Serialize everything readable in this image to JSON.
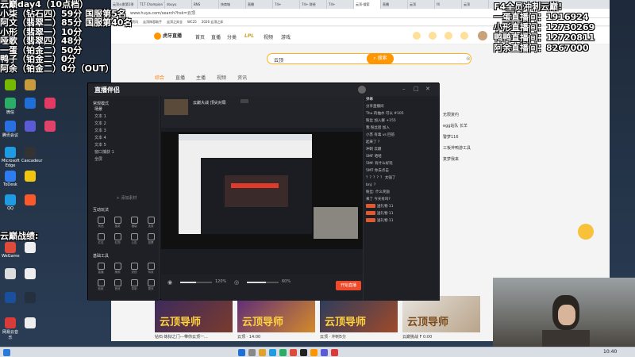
{
  "overlay_left": {
    "lines": [
      "云巅day4（10点档）",
      "小柒（钻石四）59分 国服第5名",
      "阿文（翡翠二）85分 国服第40名",
      "小形（翡翠一）10分",
      "哑歌（翡翠四）48分",
      "一蛋（铂金二）50分",
      "鸭子（铂金二）0分",
      "阿余（铂金二）0分（OUT）"
    ],
    "battle_title": "云巅战绩:"
  },
  "overlay_right": {
    "title": "F4全员冲刺云巅!",
    "lines": [
      "一蛋直播间：1916924",
      "小形直播间：12730269",
      "鸭鸭直播间：12720811",
      "阿余直播间：8267000"
    ]
  },
  "desktop_icons": [
    {
      "label": "微信",
      "color": "#2aae67"
    },
    {
      "label": "腾讯会议",
      "color": "#2a6fe0"
    },
    {
      "label": "Microsoft Edge",
      "color": "#1f9be3"
    },
    {
      "label": "ToDesk",
      "color": "#2d7cf0"
    },
    {
      "label": "QQ",
      "color": "#1f9be3"
    },
    {
      "label": "WeGame",
      "color": "#e04a3a"
    },
    {
      "label": "Cascadeur",
      "color": "#333"
    },
    {
      "label": "网易云音乐",
      "color": "#d93b3b"
    }
  ],
  "browser": {
    "url": "www.huya.com/search?hsk=云顶",
    "tabs": [
      "云顶火影第1季",
      "T1T Champion Tour",
      "douyu",
      "BNS",
      "快商城",
      "直播",
      "74+",
      "74+ 财经",
      "74+",
      "云顶-搜索",
      "直播",
      "云顶",
      "f4",
      "云顶"
    ],
    "bookmarks": [
      "云顶",
      "云顶资讯",
      "云顶阵容助手",
      "云顶之弈全",
      "WC25",
      "2026 云顶之弈"
    ],
    "logo": "虎牙直播",
    "nav": [
      "首页",
      "直播",
      "分类",
      "LPL",
      "视频",
      "游戏"
    ],
    "search_value": "云顶",
    "search_button": "搜索",
    "result_tabs": [
      "综合",
      "直播",
      "主播",
      "视频",
      "资讯"
    ],
    "side_list": [
      "无限复约",
      "egg站队 长羊",
      "警梦116",
      "三板斧鸭游工具",
      "复梦我来"
    ],
    "cards": [
      {
        "title": "云顶导师",
        "caption": "钻石·炼狱之门---带你云顶一..."
      },
      {
        "title": "云顶导师",
        "caption": "云顶 · 14:00"
      },
      {
        "title": "云顶导师",
        "caption": "云顶 · 冲刺5分"
      },
      {
        "title": "云顶导师",
        "caption": "云巅挑战 F 0:00"
      }
    ]
  },
  "live_app": {
    "title": "直播伴侣",
    "mode_label": "常规模式",
    "scene_header": "场景",
    "scenes": [
      "文本 1",
      "文本 2",
      "文本 3",
      "文本 4",
      "文本 5",
      "窗口捕获 1",
      "全屏"
    ],
    "add_source": "+ 添加素材",
    "interact_header": "互动玩法",
    "interact_tools": [
      "商品",
      "抽奖",
      "福袋",
      "连麦",
      "红包",
      "礼物",
      "公告",
      "投票"
    ],
    "basic_header": "基础工具",
    "basic_tools": [
      "直播",
      "美颜",
      "滤镜",
      "特效",
      "贴纸",
      "音效",
      "录制",
      "更多"
    ],
    "stream_title": "云巅大战 顶尖对局",
    "start_button": "开始直播",
    "volume": "120%",
    "mic": "60%",
    "chat_header": "弹幕",
    "chat": [
      "分享直播间",
      "Thu 的抽水 可以 #105",
      "粉丝 加入群 +155",
      "我 粉丝团 加入",
      "小苏 有毒 vs 回答",
      "起来了 ?",
      "冲刺 云巅",
      "SMF 哈哈",
      "5Mf: 有什么好玩",
      "5MT 你去点击",
      "？？？？？ 太强了",
      "bnj: ?",
      "粉丝: 什么奖励",
      "来了 今天有吗?",
      "送礼物 11",
      "送礼物 11",
      "送礼物 11"
    ]
  },
  "taskbar": {
    "time": "10:40"
  }
}
